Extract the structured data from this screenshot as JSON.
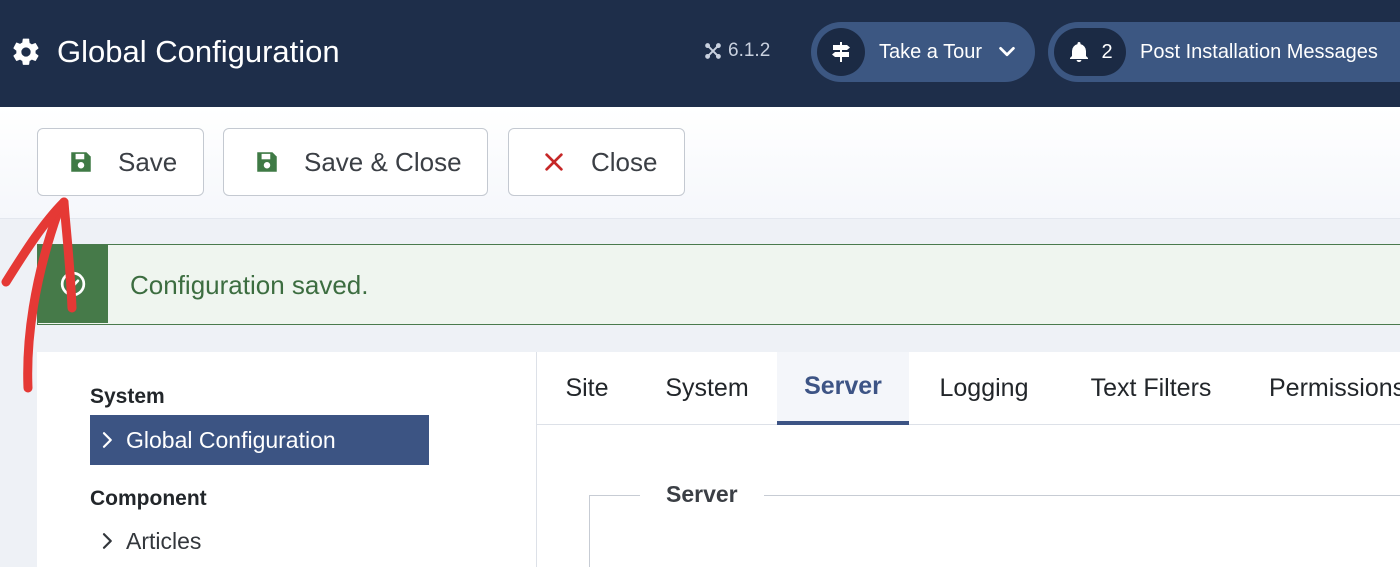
{
  "header": {
    "title": "Global Configuration",
    "version": "6.1.2",
    "tour_label": "Take a Tour",
    "notification_count": "2",
    "messages_label": "Post Installation Messages"
  },
  "toolbar": {
    "save_label": "Save",
    "save_close_label": "Save & Close",
    "close_label": "Close"
  },
  "alert": {
    "message": "Configuration saved."
  },
  "sidebar": {
    "section_system": "System",
    "item_global": "Global Configuration",
    "section_component": "Component",
    "item_articles": "Articles"
  },
  "tabs": [
    "Site",
    "System",
    "Server",
    "Logging",
    "Text Filters",
    "Permissions"
  ],
  "active_tab": "Server",
  "fieldset": {
    "legend": "Server"
  },
  "colors": {
    "header_bg": "#1e2e4a",
    "pill_bg": "#3c5782",
    "success": "#467a49",
    "active_nav": "#3c5483",
    "close_icon": "#c62828",
    "annotation_arrow": "#e53935"
  },
  "icons": {
    "title": "gear-icon",
    "version": "joomla-logo-icon",
    "tour": "signpost-icon",
    "tour_toggle": "chevron-down-icon",
    "messages": "bell-icon",
    "save": "floppy-disk-icon",
    "close": "x-icon",
    "alert": "check-circle-icon",
    "nav": "chevron-right-icon"
  }
}
